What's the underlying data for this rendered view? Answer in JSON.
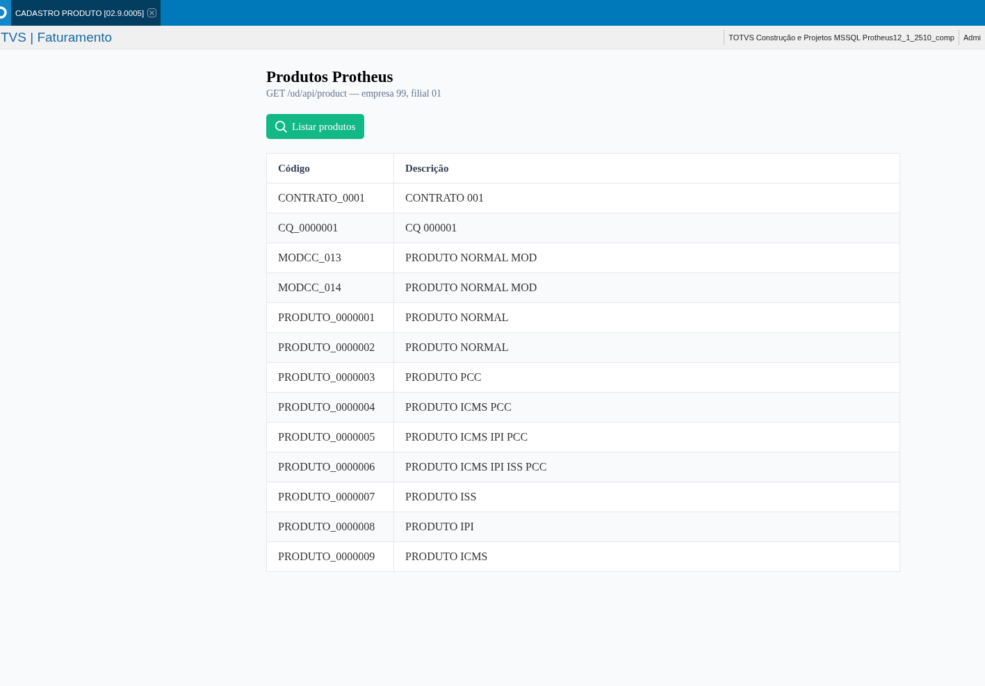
{
  "app_bar": {
    "tabs": [
      {
        "label": "CADASTRO PRODUTO [02.9.0005]",
        "selected": true
      }
    ]
  },
  "header": {
    "title": "TVS | Faturamento",
    "environment": "TOTVS Construção e Projetos MSSQL Protheus12_1_2510_comp",
    "user": "Admi"
  },
  "page": {
    "title": "Produtos Protheus",
    "subtitle": "GET /ud/api/product — empresa 99, filial 01",
    "button": "Listar produtos"
  },
  "table": {
    "columns": [
      "Código",
      "Descrição"
    ],
    "rows": [
      {
        "code": "CONTRATO_0001",
        "description": "CONTRATO 001"
      },
      {
        "code": "CQ_0000001",
        "description": "CQ 000001"
      },
      {
        "code": "MODCC_013",
        "description": "PRODUTO NORMAL MOD"
      },
      {
        "code": "MODCC_014",
        "description": "PRODUTO NORMAL MOD"
      },
      {
        "code": "PRODUTO_0000001",
        "description": "PRODUTO NORMAL"
      },
      {
        "code": "PRODUTO_0000002",
        "description": "PRODUTO NORMAL"
      },
      {
        "code": "PRODUTO_0000003",
        "description": "PRODUTO PCC"
      },
      {
        "code": "PRODUTO_0000004",
        "description": "PRODUTO ICMS PCC"
      },
      {
        "code": "PRODUTO_0000005",
        "description": "PRODUTO ICMS IPI PCC"
      },
      {
        "code": "PRODUTO_0000006",
        "description": "PRODUTO ICMS IPI ISS PCC"
      },
      {
        "code": "PRODUTO_0000007",
        "description": "PRODUTO ISS"
      },
      {
        "code": "PRODUTO_0000008",
        "description": "PRODUTO IPI"
      },
      {
        "code": "PRODUTO_0000009",
        "description": "PRODUTO ICMS"
      }
    ]
  }
}
